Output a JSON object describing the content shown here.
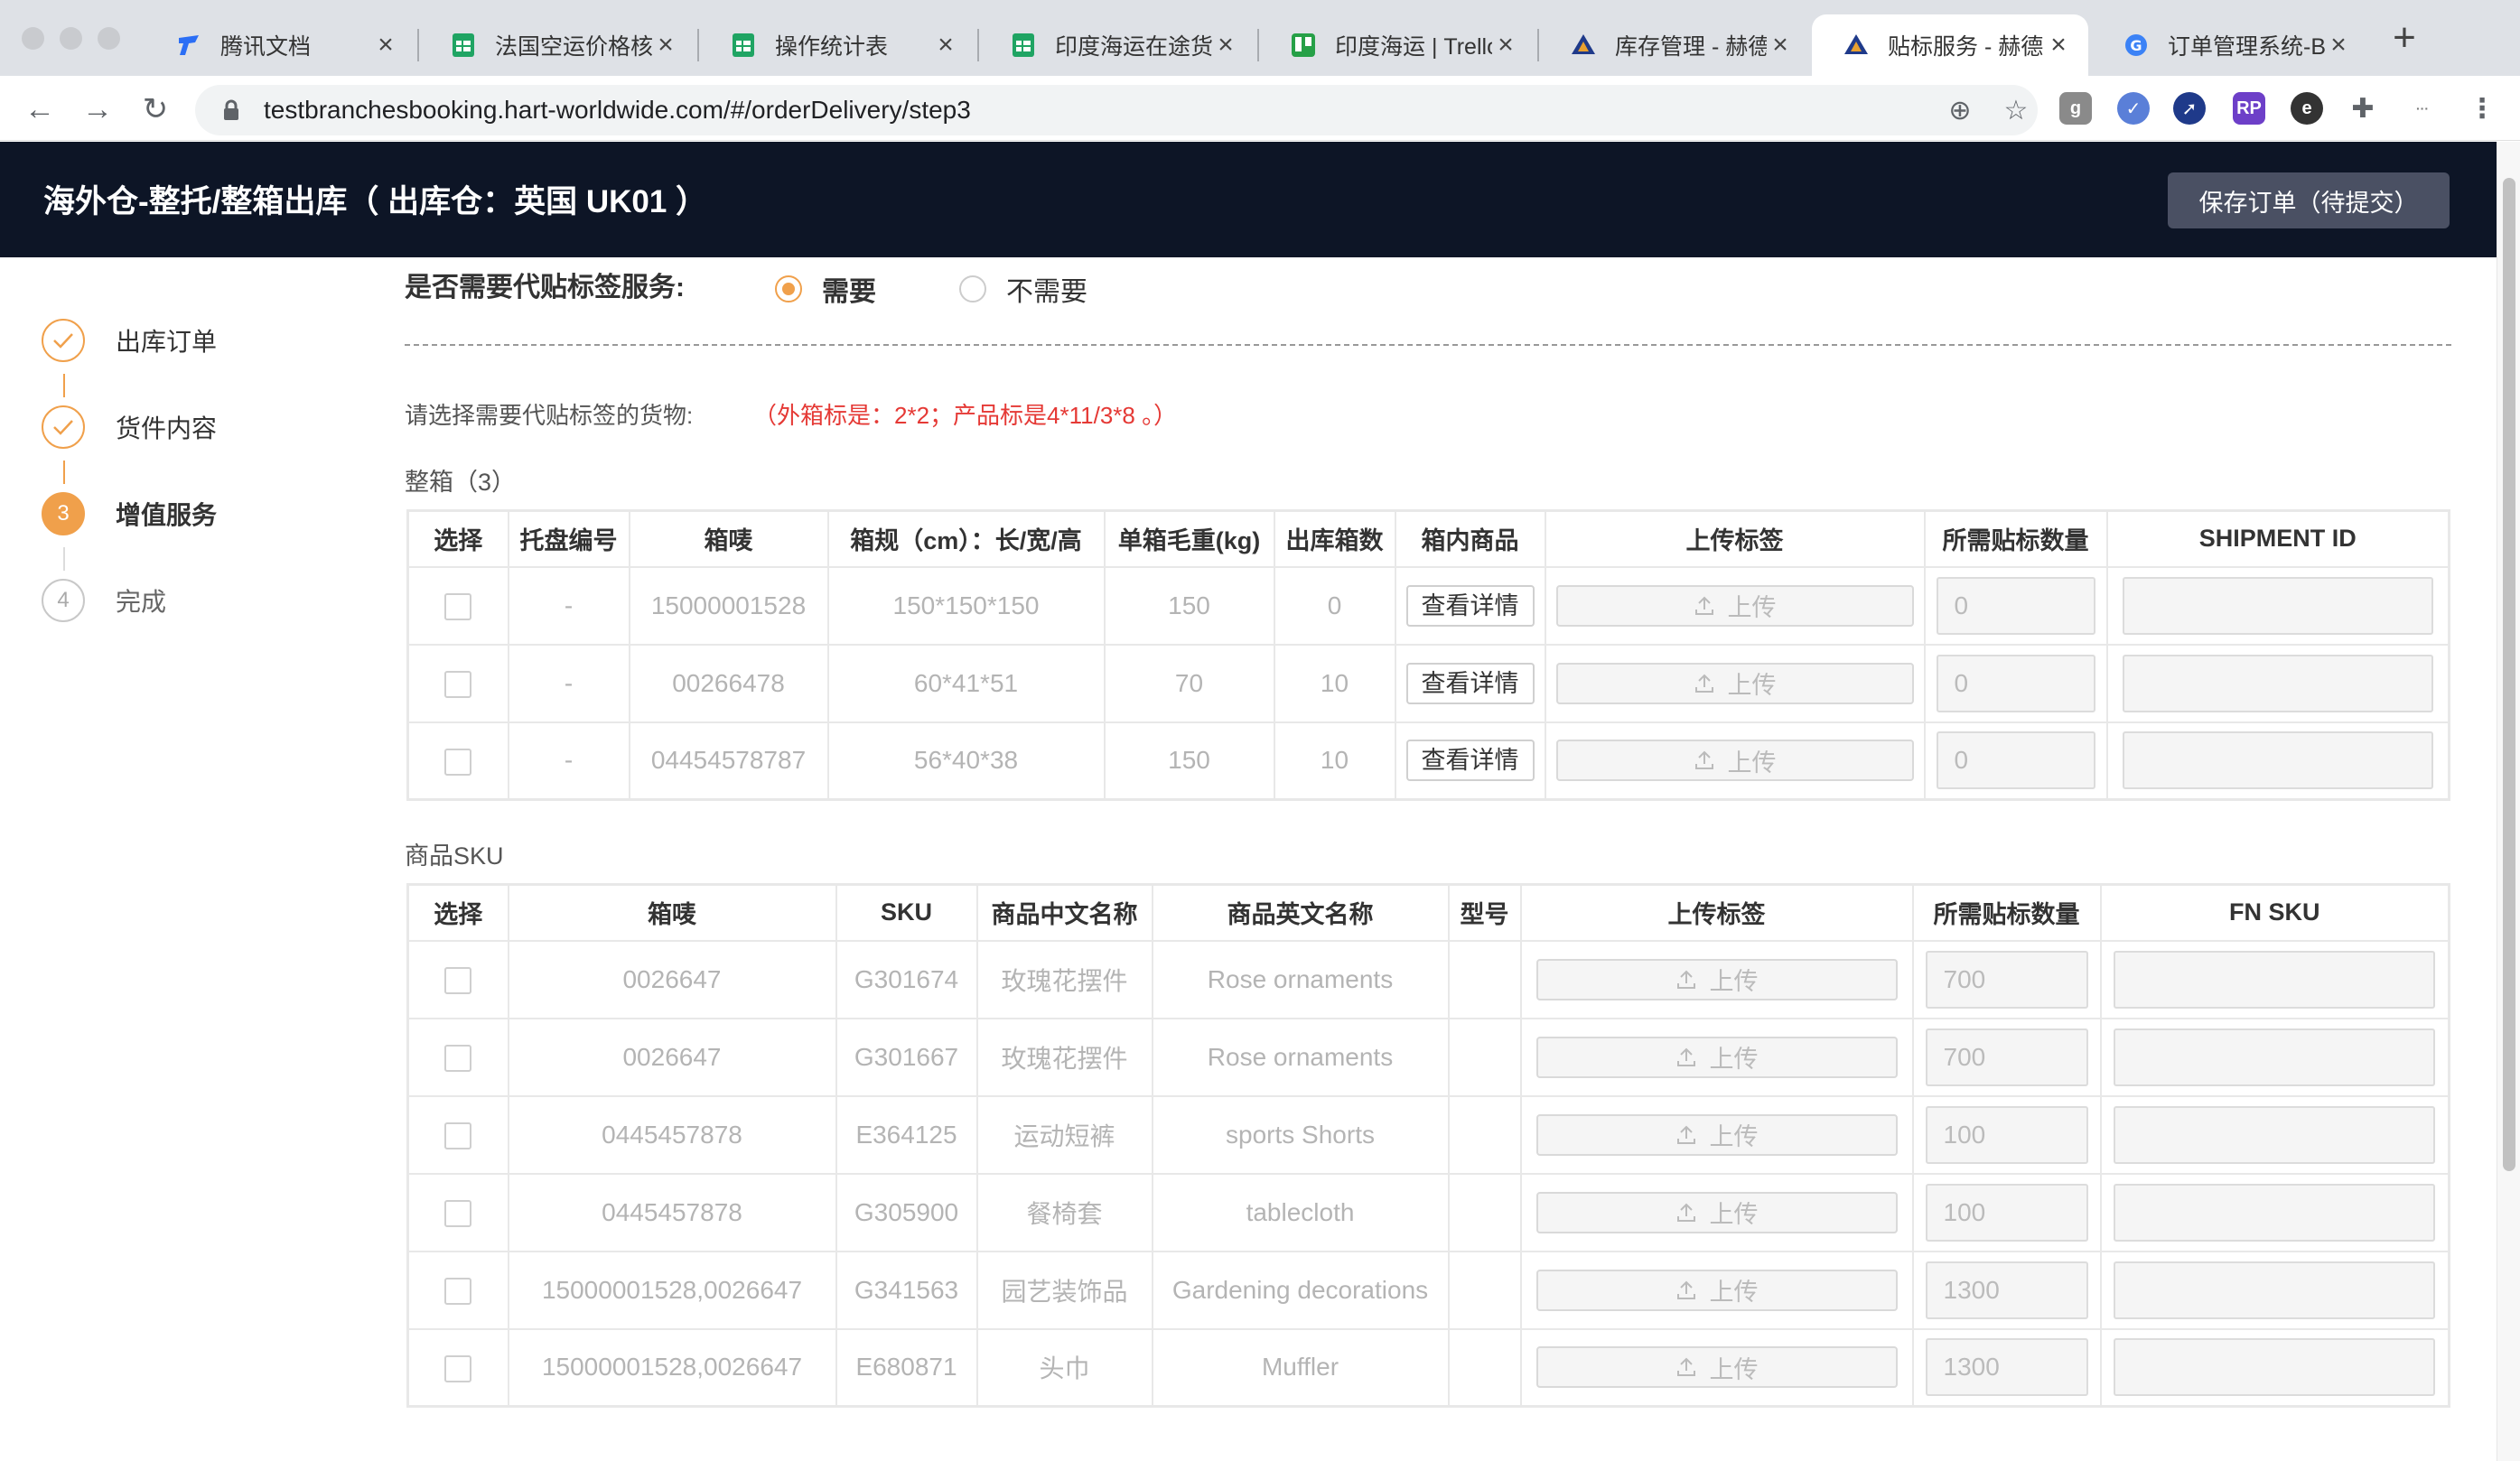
{
  "browser": {
    "tabs": [
      {
        "label": "腾讯文档",
        "icon": "tencent-docs-icon"
      },
      {
        "label": "法国空运价格核算",
        "icon": "sheet-icon"
      },
      {
        "label": "操作统计表",
        "icon": "sheet-icon"
      },
      {
        "label": "印度海运在途货物",
        "icon": "sheet-icon"
      },
      {
        "label": "印度海运 | Trello",
        "icon": "trello-icon"
      },
      {
        "label": "库存管理 - 赫德国际",
        "icon": "hart-logo-icon"
      },
      {
        "label": "贴标服务 - 赫德国际",
        "icon": "hart-logo-icon",
        "active": true
      },
      {
        "label": "订单管理系统-Booking",
        "icon": "globe-icon"
      }
    ],
    "url": "testbranchesbooking.hart-worldwide.com/#/orderDelivery/step3"
  },
  "header": {
    "title": "海外仓-整托/整箱出库（ 出库仓：英国 UK01 ）",
    "save_label": "保存订单（待提交）"
  },
  "steps": [
    {
      "num": "1",
      "label": "出库订单",
      "state": "done"
    },
    {
      "num": "2",
      "label": "货件内容",
      "state": "done"
    },
    {
      "num": "3",
      "label": "增值服务",
      "state": "current"
    },
    {
      "num": "4",
      "label": "完成",
      "state": "todo"
    }
  ],
  "labeling": {
    "question": "是否需要代贴标签服务:",
    "opt_yes": "需要",
    "opt_no": "不需要",
    "selected": "需要",
    "hint": "请选择需要代贴标签的货物:",
    "hint_red": "（外箱标是：2*2；产品标是4*11/3*8 。）"
  },
  "boxes": {
    "title": "整箱（3）",
    "columns": [
      "选择",
      "托盘编号",
      "箱唛",
      "箱规（cm）：长/宽/高",
      "单箱毛重(kg)",
      "出库箱数",
      "箱内商品",
      "上传标签",
      "所需贴标数量",
      "SHIPMENT ID"
    ],
    "detail_label": "查看详情",
    "upload_label": "上传",
    "rows": [
      {
        "pallet": "-",
        "mark": "15000001528",
        "dims": "150*150*150",
        "weight": "150",
        "count": "0",
        "qty": "0",
        "shipment": ""
      },
      {
        "pallet": "-",
        "mark": "00266478",
        "dims": "60*41*51",
        "weight": "70",
        "count": "10",
        "qty": "0",
        "shipment": ""
      },
      {
        "pallet": "-",
        "mark": "04454578787",
        "dims": "56*40*38",
        "weight": "150",
        "count": "10",
        "qty": "0",
        "shipment": ""
      }
    ]
  },
  "skus": {
    "title": "商品SKU",
    "columns": [
      "选择",
      "箱唛",
      "SKU",
      "商品中文名称",
      "商品英文名称",
      "型号",
      "上传标签",
      "所需贴标数量",
      "FN SKU"
    ],
    "upload_label": "上传",
    "rows": [
      {
        "mark": "0026647",
        "sku": "G301674",
        "cn": "玫瑰花摆件",
        "en": "Rose ornaments",
        "model": "",
        "qty": "700",
        "fnsku": ""
      },
      {
        "mark": "0026647",
        "sku": "G301667",
        "cn": "玫瑰花摆件",
        "en": "Rose ornaments",
        "model": "",
        "qty": "700",
        "fnsku": ""
      },
      {
        "mark": "0445457878",
        "sku": "E364125",
        "cn": "运动短裤",
        "en": "sports Shorts",
        "model": "",
        "qty": "100",
        "fnsku": ""
      },
      {
        "mark": "0445457878",
        "sku": "G305900",
        "cn": "餐椅套",
        "en": "tablecloth",
        "model": "",
        "qty": "100",
        "fnsku": ""
      },
      {
        "mark": "15000001528,0026647",
        "sku": "G341563",
        "cn": "园艺装饰品",
        "en": "Gardening decorations",
        "model": "",
        "qty": "1300",
        "fnsku": ""
      },
      {
        "mark": "15000001528,0026647",
        "sku": "E680871",
        "cn": "头巾",
        "en": "Muffler",
        "model": "",
        "qty": "1300",
        "fnsku": ""
      }
    ]
  },
  "colors": {
    "accent": "#f0a04b",
    "header_bg": "#0d1526",
    "hint_red": "#e53935"
  }
}
